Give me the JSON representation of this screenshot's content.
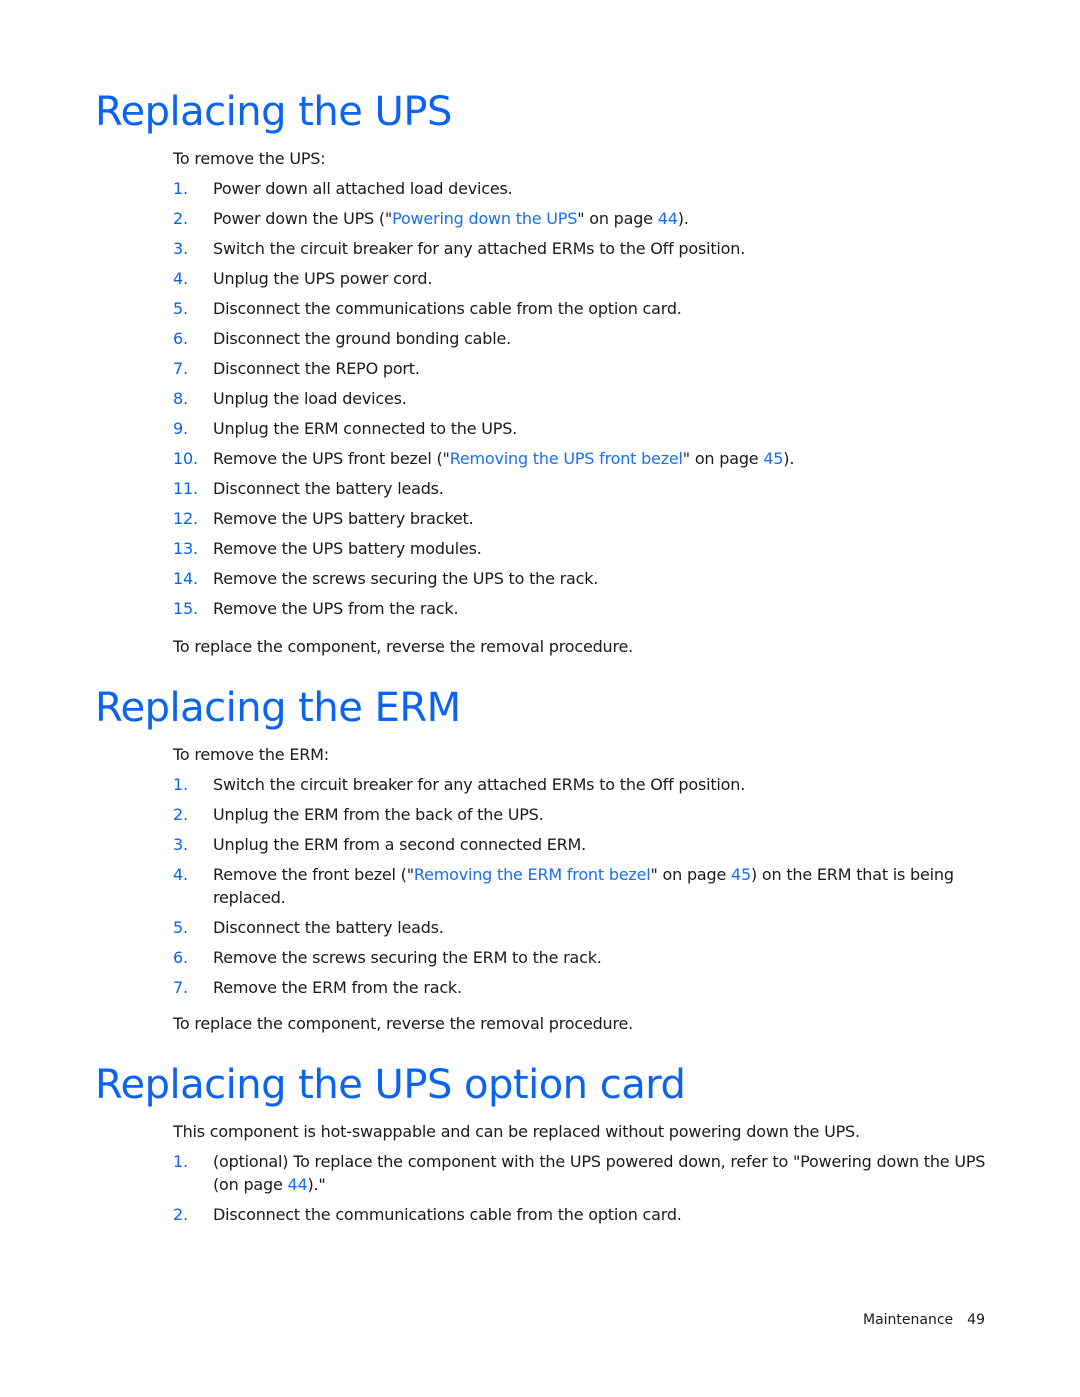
{
  "colors": {
    "heading": "#0a64f0",
    "link": "#1a6ef0",
    "step_number": "#0a64f0",
    "text": "#1a1a1a"
  },
  "sections": [
    {
      "title": "Replacing the UPS",
      "intro": "To remove the UPS:",
      "steps": [
        {
          "num": "1.",
          "parts": [
            {
              "text": "Power down all attached load devices."
            }
          ]
        },
        {
          "num": "2.",
          "parts": [
            {
              "text": "Power down the UPS (\""
            },
            {
              "link": "Powering down the UPS"
            },
            {
              "text": "\" on page "
            },
            {
              "link": "44"
            },
            {
              "text": ")."
            }
          ]
        },
        {
          "num": "3.",
          "parts": [
            {
              "text": "Switch the circuit breaker for any attached ERMs to the Off position."
            }
          ]
        },
        {
          "num": "4.",
          "parts": [
            {
              "text": "Unplug the UPS power cord."
            }
          ]
        },
        {
          "num": "5.",
          "parts": [
            {
              "text": "Disconnect the communications cable from the option card."
            }
          ]
        },
        {
          "num": "6.",
          "parts": [
            {
              "text": "Disconnect the ground bonding cable."
            }
          ]
        },
        {
          "num": "7.",
          "parts": [
            {
              "text": "Disconnect the REPO port."
            }
          ]
        },
        {
          "num": "8.",
          "parts": [
            {
              "text": "Unplug the load devices."
            }
          ]
        },
        {
          "num": "9.",
          "parts": [
            {
              "text": "Unplug the ERM connected to the UPS."
            }
          ]
        },
        {
          "num": "10.",
          "parts": [
            {
              "text": "Remove the UPS front bezel (\""
            },
            {
              "link": "Removing the UPS front bezel"
            },
            {
              "text": "\" on page "
            },
            {
              "link": "45"
            },
            {
              "text": ")."
            }
          ]
        },
        {
          "num": "11.",
          "parts": [
            {
              "text": "Disconnect the battery leads."
            }
          ]
        },
        {
          "num": "12.",
          "parts": [
            {
              "text": "Remove the UPS battery bracket."
            }
          ]
        },
        {
          "num": "13.",
          "parts": [
            {
              "text": "Remove the UPS battery modules."
            }
          ]
        },
        {
          "num": "14.",
          "parts": [
            {
              "text": "Remove the screws securing the UPS to the rack."
            }
          ]
        },
        {
          "num": "15.",
          "parts": [
            {
              "text": "Remove the UPS from the rack."
            }
          ]
        }
      ],
      "outro": "To replace the component, reverse the removal procedure."
    },
    {
      "title": "Replacing the ERM",
      "intro": "To remove the ERM:",
      "steps": [
        {
          "num": "1.",
          "parts": [
            {
              "text": "Switch the circuit breaker for any attached ERMs to the Off position."
            }
          ]
        },
        {
          "num": "2.",
          "parts": [
            {
              "text": "Unplug the ERM from the back of the UPS."
            }
          ]
        },
        {
          "num": "3.",
          "parts": [
            {
              "text": "Unplug the ERM from a second connected ERM."
            }
          ]
        },
        {
          "num": "4.",
          "parts": [
            {
              "text": "Remove the front bezel (\""
            },
            {
              "link": "Removing the ERM front bezel"
            },
            {
              "text": "\" on page "
            },
            {
              "link": "45"
            },
            {
              "text": ") on the ERM that is being replaced."
            }
          ]
        },
        {
          "num": "5.",
          "parts": [
            {
              "text": "Disconnect the battery leads."
            }
          ]
        },
        {
          "num": "6.",
          "parts": [
            {
              "text": "Remove the screws securing the ERM to the rack."
            }
          ]
        },
        {
          "num": "7.",
          "parts": [
            {
              "text": "Remove the ERM from the rack."
            }
          ]
        }
      ],
      "outro": "To replace the component, reverse the removal procedure."
    },
    {
      "title": "Replacing the UPS option card",
      "intro": "This component is hot-swappable and can be replaced without powering down the UPS.",
      "steps": [
        {
          "num": "1.",
          "parts": [
            {
              "text": "(optional) To replace the component with the UPS powered down, refer to \"Powering down the UPS (on page "
            },
            {
              "link": "44"
            },
            {
              "text": ").\""
            }
          ]
        },
        {
          "num": "2.",
          "parts": [
            {
              "text": "Disconnect the communications cable from the option card."
            }
          ]
        }
      ],
      "outro": ""
    }
  ],
  "footer": {
    "section": "Maintenance",
    "page_number": "49"
  }
}
